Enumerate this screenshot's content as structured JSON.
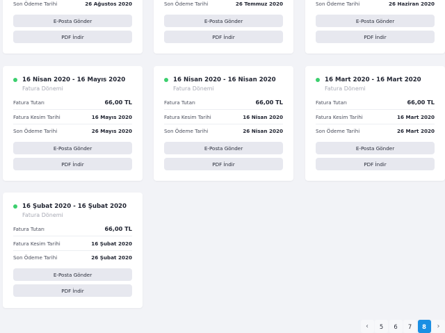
{
  "labels": {
    "amount": "Fatura Tutarı",
    "issue_date": "Fatura Kesim Tarihi",
    "due_date": "Son Ödeme Tarihi",
    "period_subtitle": "Fatura Dönemi",
    "send_einvoice": "E-Posta Gönder",
    "download_pdf": "PDF İndir"
  },
  "partial_cards": [
    {
      "due_date": "26 Ağustos 2020"
    },
    {
      "due_date": "26 Temmuz 2020"
    },
    {
      "due_date": "26 Haziran 2020"
    }
  ],
  "cards": [
    {
      "period": "16 Nisan 2020 - 16 Mayıs 2020",
      "amount": "66,00 TL",
      "issue_date": "16 Mayıs 2020",
      "due_date": "26 Mayıs 2020"
    },
    {
      "period": "16 Nisan 2020 - 16 Nisan 2020",
      "amount": "66,00 TL",
      "issue_date": "16 Nisan 2020",
      "due_date": "26 Nisan 2020"
    },
    {
      "period": "16 Mart 2020 - 16 Mart 2020",
      "amount": "66,00 TL",
      "issue_date": "16 Mart 2020",
      "due_date": "26 Mart 2020"
    },
    {
      "period": "16 Şubat 2020 - 16 Şubat 2020",
      "amount": "66,00 TL",
      "issue_date": "16 Şubat 2020",
      "due_date": "26 Şubat 2020"
    }
  ],
  "pagination": {
    "prev_icon": "chevron-left-icon",
    "next_icon": "chevron-right-icon",
    "pages": [
      "5",
      "6",
      "7",
      "8"
    ],
    "current": "8"
  },
  "colors": {
    "status_dot": "#3ccf6e",
    "active_page": "#1a8fe3"
  }
}
